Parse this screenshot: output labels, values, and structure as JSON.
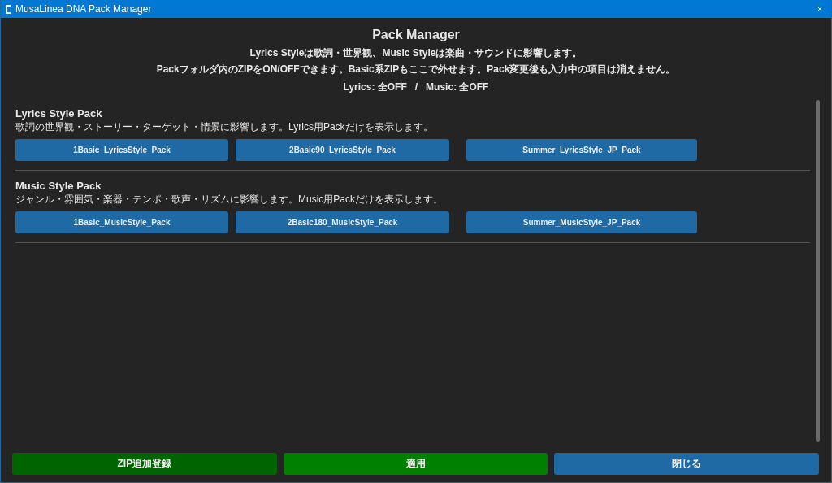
{
  "window": {
    "title": "MusaLinea DNA Pack Manager"
  },
  "header": {
    "title": "Pack Manager",
    "lines": [
      "Lyrics Styleは歌詞・世界観、Music Styleは楽曲・サウンドに影響します。",
      "Packフォルダ内のZIPをON/OFFできます。Basic系ZIPもここで外せます。Pack変更後も入力中の項目は消えません。"
    ],
    "status": "Lyrics: 全OFF   /   Music: 全OFF"
  },
  "sections": [
    {
      "title": "Lyrics Style Pack",
      "description": "歌詞の世界観・ストーリー・ターゲット・情景に影響します。Lyrics用Packだけを表示します。",
      "packs": [
        "1Basic_LyricsStyle_Pack",
        "2Basic90_LyricsStyle_Pack",
        "Summer_LyricsStyle_JP_Pack"
      ]
    },
    {
      "title": "Music Style Pack",
      "description": "ジャンル・雰囲気・楽器・テンポ・歌声・リズムに影響します。Music用Packだけを表示します。",
      "packs": [
        "1Basic_MusicStyle_Pack",
        "2Basic180_MusicStyle_Pack",
        "Summer_MusicStyle_JP_Pack"
      ]
    }
  ],
  "footer_buttons": [
    {
      "label": "ZIP追加登録",
      "kind": "add"
    },
    {
      "label": "適用",
      "kind": "apply"
    },
    {
      "label": "閉じる",
      "kind": "close"
    }
  ]
}
